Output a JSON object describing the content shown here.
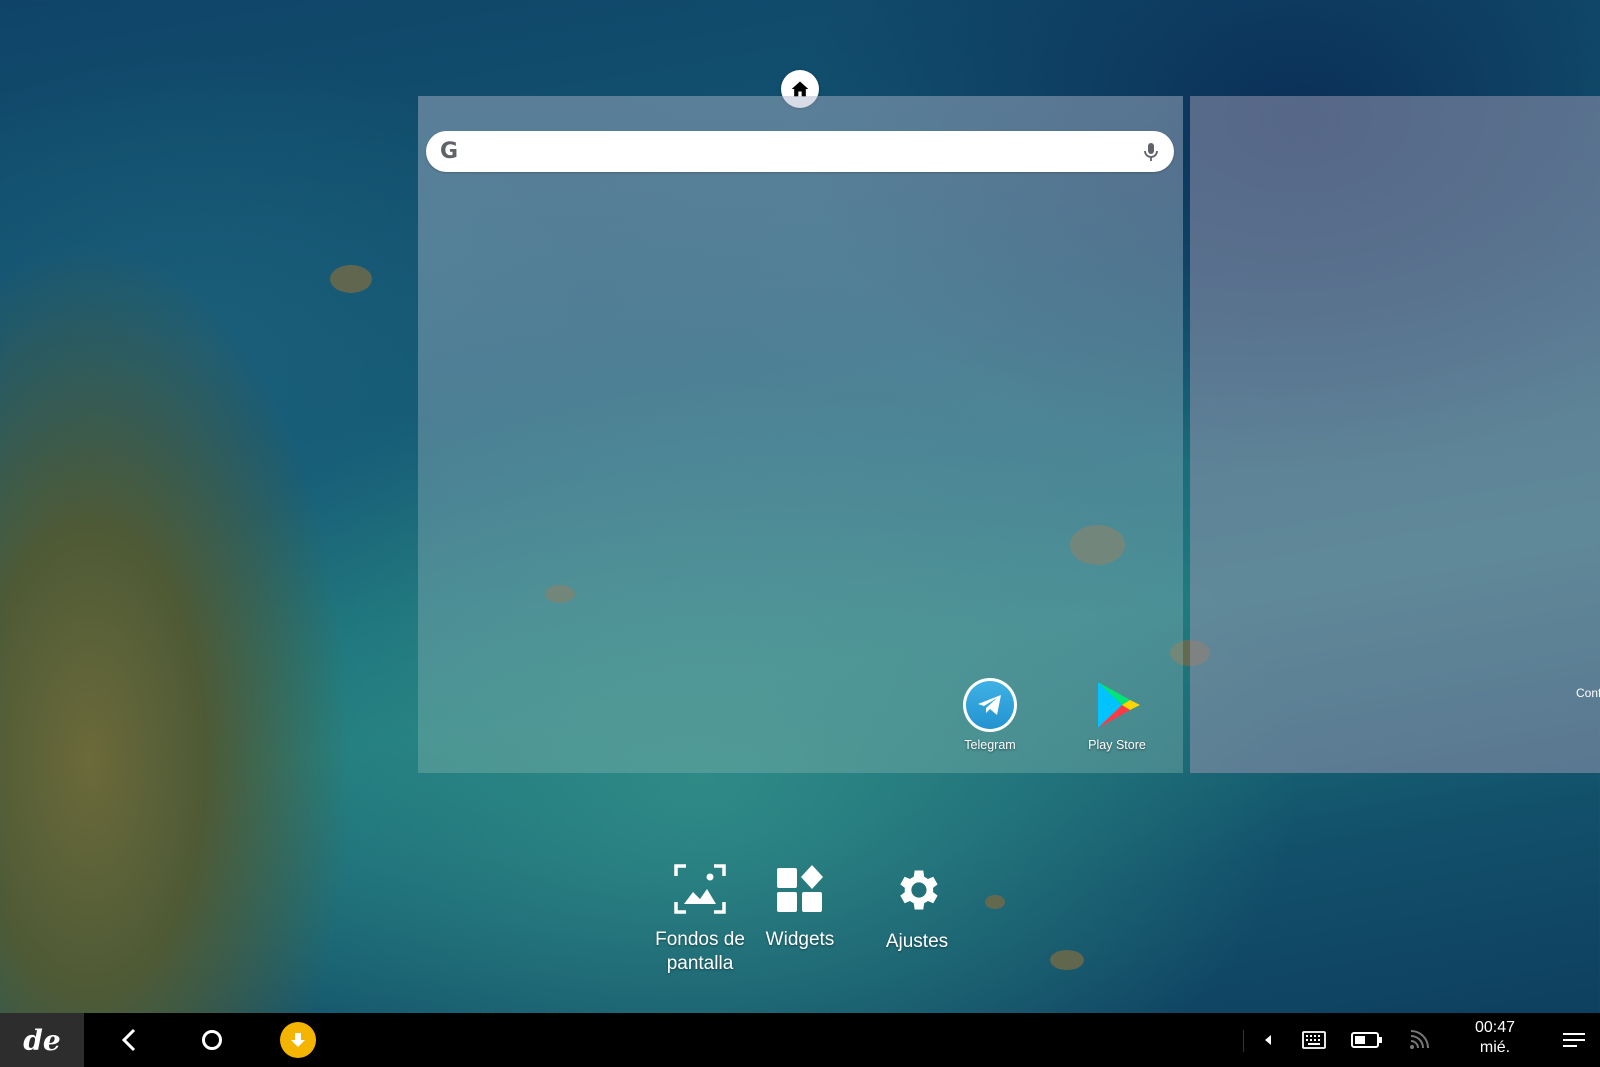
{
  "wallpaper": {
    "accent_sea": "#1e7a7e",
    "accent_deep": "#0d3b5c"
  },
  "home_indicator": {
    "icon": "home-icon"
  },
  "search": {
    "logo": "G",
    "value": "",
    "mic_icon": "mic-icon"
  },
  "apps": [
    {
      "label": "Telegram",
      "icon": "telegram-icon"
    },
    {
      "label": "Play Store",
      "icon": "play-store-icon"
    }
  ],
  "next_page_peek": {
    "label": "Conf"
  },
  "options": {
    "wallpapers": {
      "label_line1": "Fondos de",
      "label_line2": "pantalla",
      "icon": "wallpaper-icon"
    },
    "widgets": {
      "label": "Widgets",
      "icon": "widgets-icon"
    },
    "settings": {
      "label": "Ajustes",
      "icon": "gear-icon"
    }
  },
  "taskbar": {
    "logo": "de",
    "back_icon": "back-arrow-icon",
    "home_icon": "home-circle-icon",
    "download_icon": "download-icon",
    "download_color": "#f4b400",
    "tray": [
      "chevron-left-icon",
      "keyboard-icon",
      "battery-icon",
      "cast-icon"
    ],
    "time": "00:47",
    "day": "mié.",
    "menu_icon": "notifications-menu-icon"
  }
}
